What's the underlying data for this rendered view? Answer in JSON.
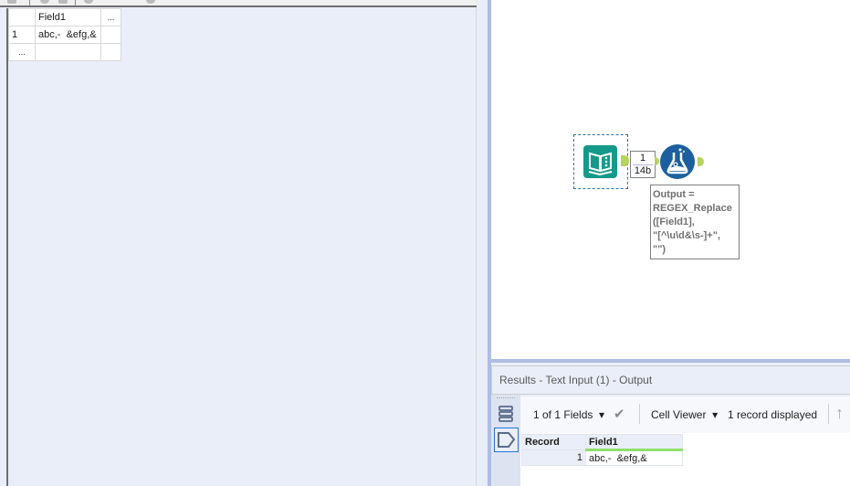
{
  "input_grid": {
    "header": [
      "",
      "Field1",
      "..."
    ],
    "rows": [
      [
        "1",
        "abc,-  &efg,&",
        ""
      ],
      [
        "...",
        "",
        ""
      ]
    ]
  },
  "canvas": {
    "tools": [
      {
        "name": "Text Input",
        "icon": "book-icon",
        "color": "#159a8a"
      },
      {
        "name": "Formula",
        "icon": "flask-icon",
        "color": "#1d5f9e"
      }
    ],
    "connection": {
      "records": "1",
      "size": "14b"
    },
    "annotation": "Output =\nREGEX_Replace\n([Field1],\n\"[^\\u\\d&\\s-]+\",\n\"\")"
  },
  "results": {
    "title": "Results - Text Input (1) - Output",
    "toolbar": {
      "fields": "1 of 1 Fields",
      "cell_viewer": "Cell Viewer",
      "records_displayed": "1 record displayed"
    },
    "table": {
      "columns": [
        "Record",
        "Field1"
      ],
      "rows": [
        [
          "1",
          "abc,-  &efg,&"
        ]
      ]
    },
    "colors": {
      "field_header_accent": "#8fe06a",
      "selected_view": "#1e7ad6"
    }
  }
}
